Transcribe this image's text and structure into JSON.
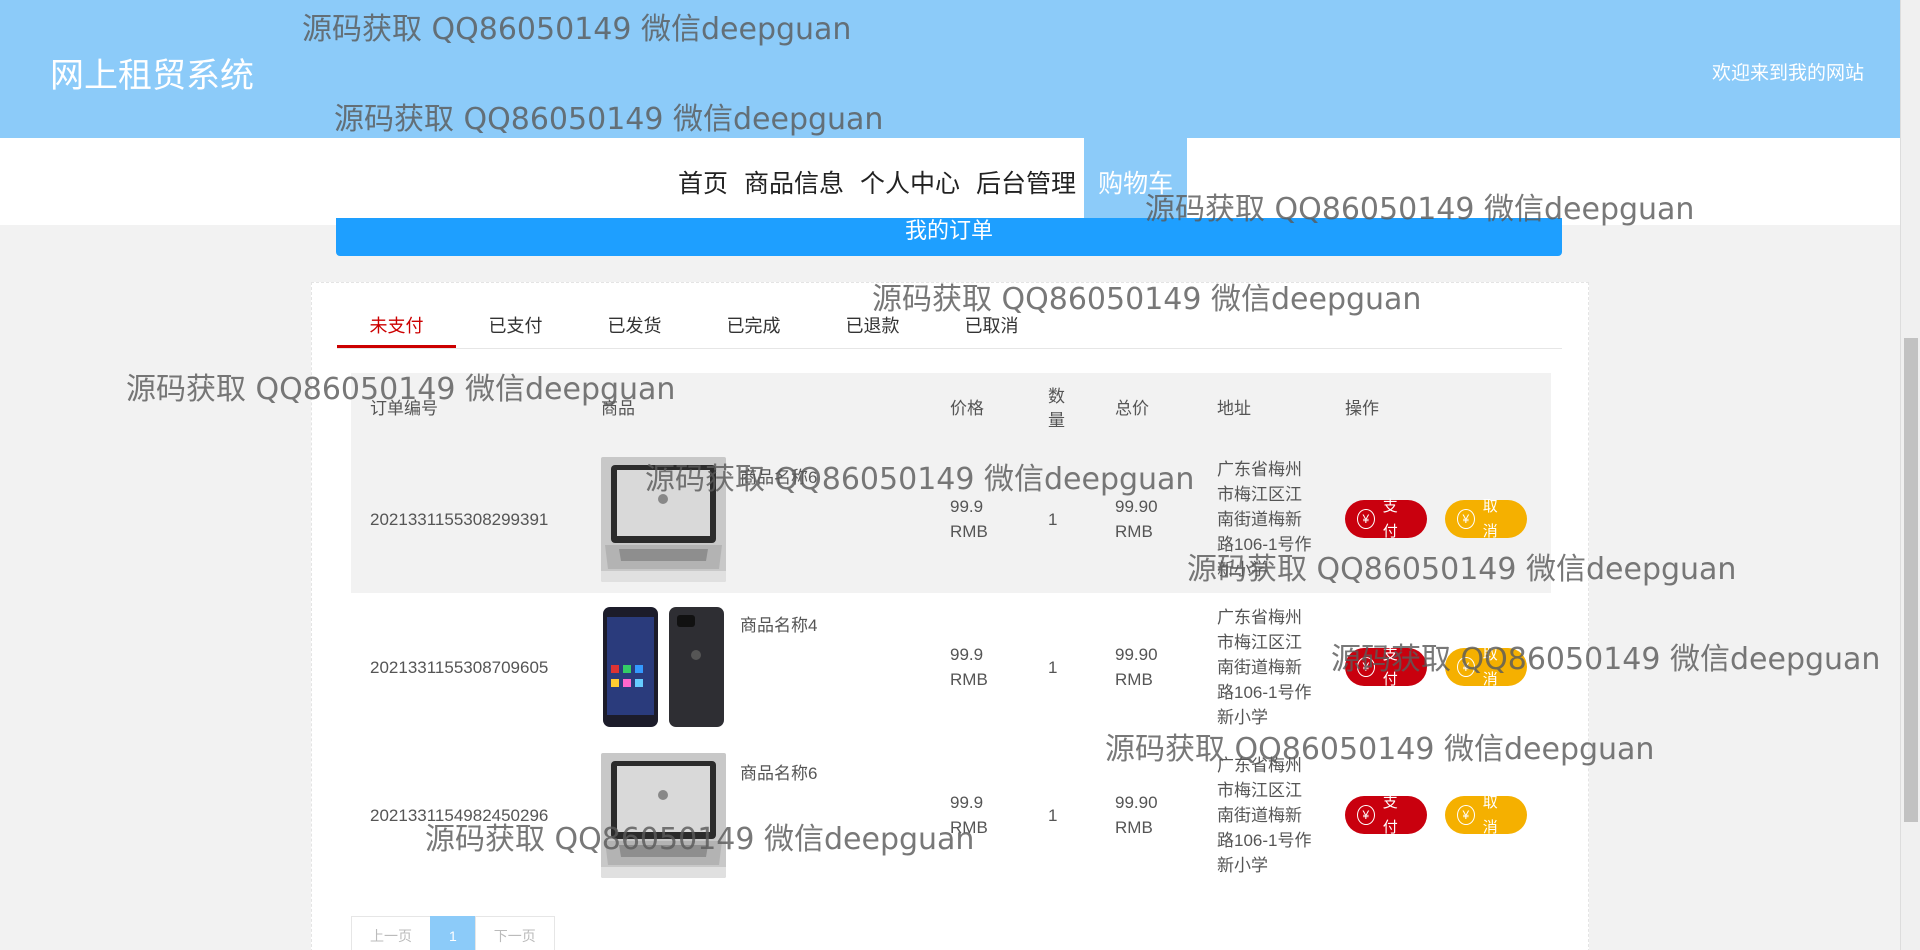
{
  "header": {
    "brand": "网上租贸系统",
    "welcome": "欢迎来到我的网站"
  },
  "nav": {
    "items": [
      {
        "label": "首页"
      },
      {
        "label": "商品信息"
      },
      {
        "label": "个人中心"
      },
      {
        "label": "后台管理"
      },
      {
        "label": "购物车",
        "active": true
      }
    ]
  },
  "banner": {
    "title": "我的订单"
  },
  "tabs": [
    {
      "label": "未支付",
      "active": true
    },
    {
      "label": "已支付"
    },
    {
      "label": "已发货"
    },
    {
      "label": "已完成"
    },
    {
      "label": "已退款"
    },
    {
      "label": "已取消"
    }
  ],
  "table": {
    "headers": {
      "order_id": "订单编号",
      "goods": "商品",
      "price": "价格",
      "qty": "数量",
      "total": "总价",
      "address": "地址",
      "ops": "操作"
    },
    "rows": [
      {
        "order_id": "2021331155308299391",
        "goods_name": "商品名称6",
        "image": "laptop",
        "price": "99.9 RMB",
        "qty": "1",
        "total": "99.90 RMB",
        "address": "广东省梅州市梅江区江南街道梅新路106-1号作新小学",
        "pay_label": "支付",
        "cancel_label": "取消"
      },
      {
        "order_id": "2021331155308709605",
        "goods_name": "商品名称4",
        "image": "phone",
        "price": "99.9 RMB",
        "qty": "1",
        "total": "99.90 RMB",
        "address": "广东省梅州市梅江区江南街道梅新路106-1号作新小学",
        "pay_label": "支付",
        "cancel_label": "取消"
      },
      {
        "order_id": "2021331154982450296",
        "goods_name": "商品名称6",
        "image": "laptop",
        "price": "99.9 RMB",
        "qty": "1",
        "total": "99.90 RMB",
        "address": "广东省梅州市梅江区江南街道梅新路106-1号作新小学",
        "pay_label": "支付",
        "cancel_label": "取消"
      }
    ]
  },
  "pager": {
    "prev": "上一页",
    "current": "1",
    "next": "下一页"
  },
  "watermark": {
    "text": "源码获取 QQ86050149 微信deepguan"
  },
  "colors": {
    "header": "#8ccbf9",
    "banner": "#1e9fff",
    "pay": "#c9000e",
    "cancel": "#f5b000",
    "active_tab": "#cc0000"
  }
}
